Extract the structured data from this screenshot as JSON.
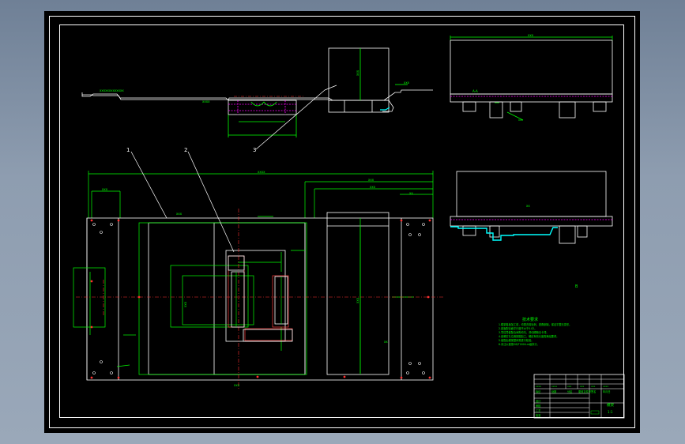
{
  "viewport": {
    "name": "cad-drawing-viewport"
  },
  "colors": {
    "background": "#000000",
    "frame": "#ffffff",
    "dimension": "#00ff00",
    "centerline": "#ff3030",
    "hidden": "#ff00ff",
    "section": "#00ffff"
  },
  "title_block": {
    "drawing_name": "模架",
    "scale": "1:1",
    "headers": [
      "标记",
      "处数",
      "分区",
      "更改文件号",
      "签名",
      "年月日"
    ],
    "approval": [
      "设计",
      "审核",
      "工艺",
      "批准"
    ]
  },
  "technical_requirements": {
    "heading": "技术要求",
    "lines": [
      "1.模架各板加工前，均需去除毛刺，锐角倒钝，保证平整无变形。",
      "2.各板配合面平行度不大于0.02。",
      "3.导柱导套配合间隙均匀，滑动顺畅无卡滞。",
      "4.各螺钉孔位置按图加工，螺纹有效长度需满足要求。",
      "5.装配后模架整体需进行检验。",
      "6.未注公差按GB/T1804-m级执行。"
    ]
  },
  "balloons": [
    "1",
    "2",
    "3"
  ],
  "view_labels": [
    "A-A",
    "B"
  ]
}
